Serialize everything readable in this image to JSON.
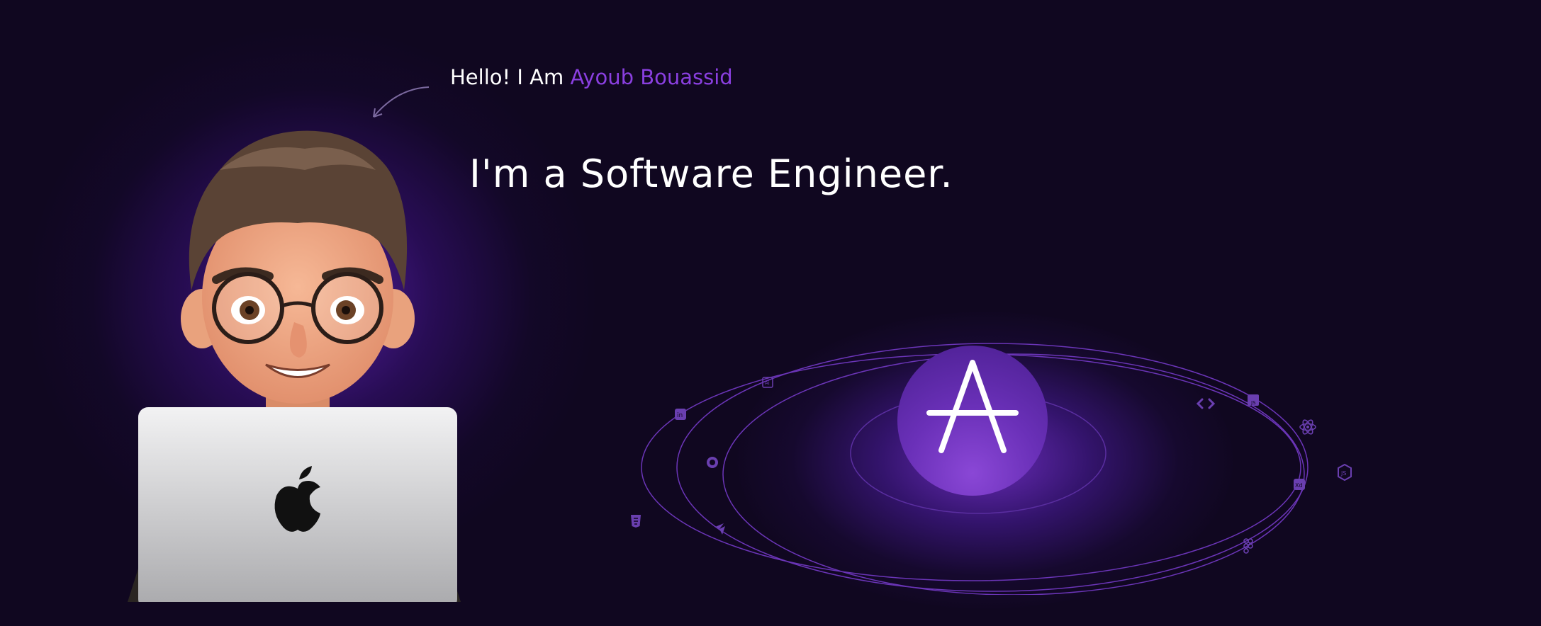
{
  "hero": {
    "greeting_prefix": "Hello! I Am ",
    "greeting_name": "Ayoub Bouassid",
    "headline": "I'm a Software Engineer."
  },
  "colors": {
    "background": "#100720",
    "accent": "#8a3fe0",
    "text": "#ffffff"
  },
  "icons": {
    "avatar": "memoji-avatar-with-laptop",
    "logo": "letter-a-logo",
    "orbit_icons": [
      "adobe-illustrator-icon",
      "linkedin-icon",
      "github-icon",
      "html5-icon",
      "flutter-icon",
      "code-brackets-icon",
      "javascript-icon",
      "react-icon",
      "adobe-xd-icon",
      "nodejs-icon",
      "figma-icon"
    ]
  }
}
